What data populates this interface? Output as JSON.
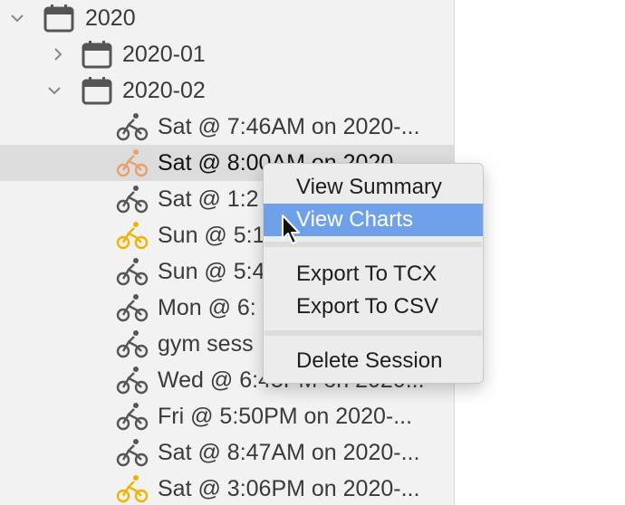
{
  "tree": {
    "year": {
      "label": "2020",
      "icon": "calendar-icon",
      "expanded": true
    },
    "months": [
      {
        "label": "2020-01",
        "icon": "calendar-icon",
        "expanded": false
      },
      {
        "label": "2020-02",
        "icon": "calendar-icon",
        "expanded": true
      }
    ],
    "sessions": [
      {
        "label": "Sat @ 7:46AM on 2020-...",
        "icon": "bike-icon",
        "color": "#555555"
      },
      {
        "label": "Sat @ 8:00AM on 2020...",
        "icon": "bike-icon",
        "color": "#e8a06c",
        "selected": true
      },
      {
        "label": "Sat @ 1:2",
        "icon": "bike-icon",
        "color": "#555555"
      },
      {
        "label": "Sun @ 5:1",
        "icon": "bike-icon",
        "color": "#f2b300"
      },
      {
        "label": "Sun @ 5:4",
        "icon": "bike-icon",
        "color": "#555555"
      },
      {
        "label": "Mon @ 6:",
        "icon": "bike-icon",
        "color": "#555555"
      },
      {
        "label": "gym sess",
        "icon": "bike-icon",
        "color": "#555555"
      },
      {
        "label": "Wed @ 6:45PM on 2020...",
        "icon": "bike-icon",
        "color": "#555555"
      },
      {
        "label": "Fri @ 5:50PM on 2020-...",
        "icon": "bike-icon",
        "color": "#555555"
      },
      {
        "label": "Sat @ 8:47AM on 2020-...",
        "icon": "bike-icon",
        "color": "#555555"
      },
      {
        "label": "Sat @ 3:06PM on 2020-...",
        "icon": "bike-icon",
        "color": "#f2b300"
      }
    ]
  },
  "context_menu": {
    "items": [
      {
        "label": "View Summary"
      },
      {
        "label": "View Charts",
        "highlighted": true
      },
      {
        "label": "Export To TCX"
      },
      {
        "label": "Export To CSV"
      },
      {
        "label": "Delete Session"
      }
    ],
    "highlight_color": "#6fa1ea"
  }
}
